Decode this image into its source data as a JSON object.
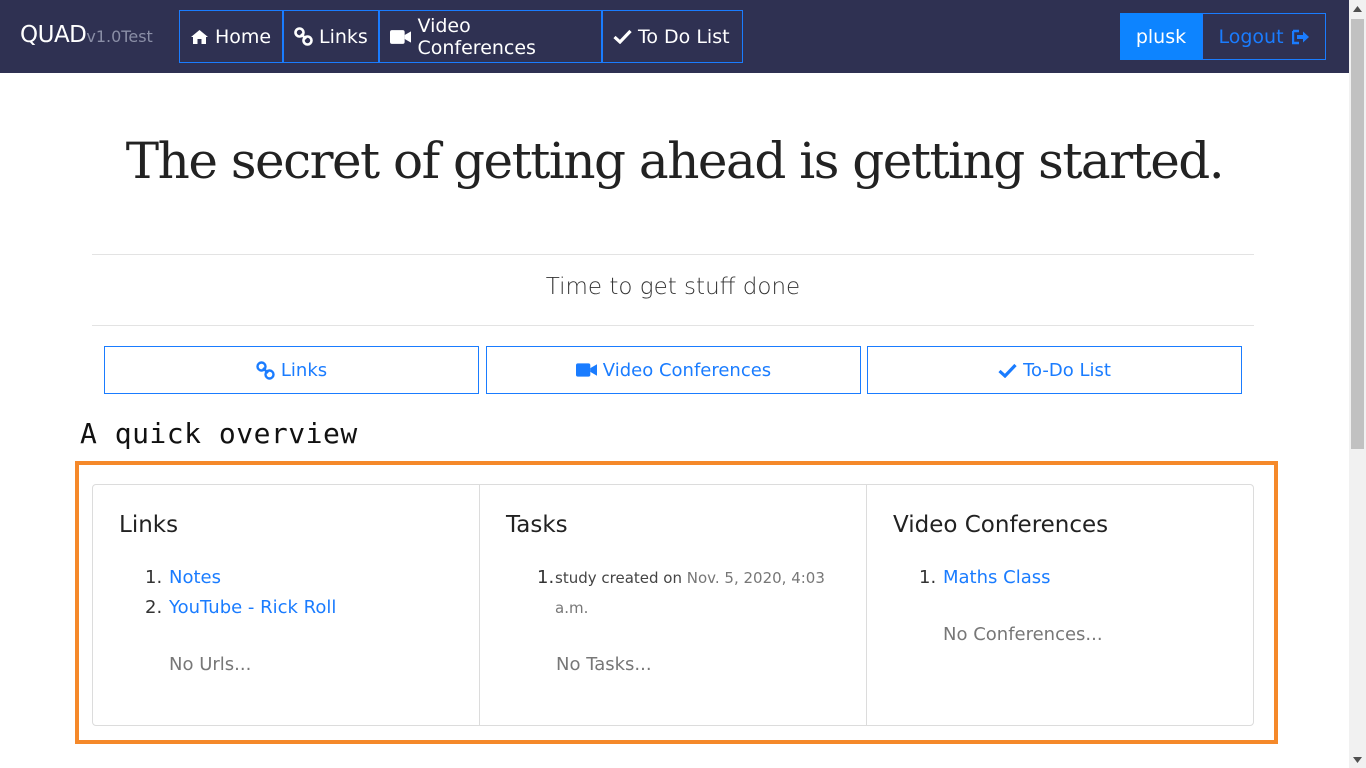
{
  "navbar": {
    "brand": "QUAD",
    "version": "v1.0Test",
    "links": [
      {
        "label": "Home",
        "icon": "home-icon"
      },
      {
        "label": "Links",
        "icon": "link-icon"
      },
      {
        "label": "Video Conferences",
        "icon": "video-camera-icon"
      },
      {
        "label": "To Do List",
        "icon": "check-icon"
      }
    ],
    "user": "plusk",
    "logout": "Logout"
  },
  "hero": {
    "quote": "The secret of getting ahead is getting started.",
    "lead": "Time to get stuff done"
  },
  "quick_buttons": [
    {
      "label": "Links",
      "icon": "link-icon"
    },
    {
      "label": "Video Conferences",
      "icon": "video-camera-icon"
    },
    {
      "label": "To-Do List",
      "icon": "check-icon"
    }
  ],
  "overview": {
    "title": "A quick overview",
    "links": {
      "title": "Links",
      "items": [
        {
          "num": "1.",
          "label": "Notes"
        },
        {
          "num": "2.",
          "label": "YouTube - Rick Roll"
        }
      ],
      "empty": "No Urls..."
    },
    "tasks": {
      "title": "Tasks",
      "items": [
        {
          "num": "1.",
          "name": "study",
          "created": " created ",
          "on": "on",
          "date": " Nov. 5, 2020, 4:03 a.m."
        }
      ],
      "empty": "No Tasks..."
    },
    "conferences": {
      "title": "Video Conferences",
      "items": [
        {
          "num": "1.",
          "label": "Maths Class"
        }
      ],
      "empty": "No Conferences..."
    }
  },
  "colors": {
    "navbar_bg": "#2f3152",
    "accent": "#1a7cff",
    "highlight": "#f5892a"
  }
}
